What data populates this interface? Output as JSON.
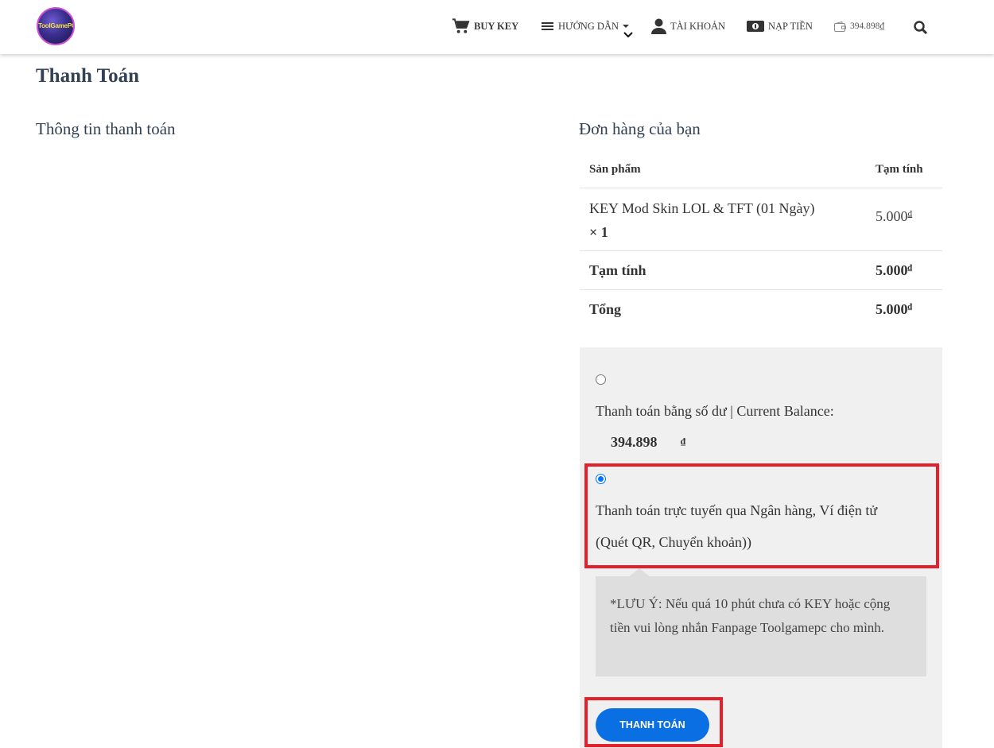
{
  "header": {
    "logo_text": "ToolGamePC",
    "nav": {
      "buy_key": "BUY KEY",
      "huong_dan": "HƯỚNG DẪN",
      "tai_khoan": "TÀI KHOẢN",
      "nap_tien": "NẠP TIỀN",
      "balance": "394.898₫"
    },
    "icons": [
      "cart-icon",
      "menu-icon",
      "chevron-down-icon",
      "user-icon",
      "money-icon",
      "wallet-icon",
      "search-icon"
    ]
  },
  "page": {
    "title": "Thanh Toán",
    "billing_title": "Thông tin thanh toán",
    "order_title": "Đơn hàng của bạn"
  },
  "order": {
    "headers": {
      "product": "Sản phẩm",
      "subtotal": "Tạm tính"
    },
    "item": {
      "name": "KEY Mod Skin LOL & TFT (01 Ngày)",
      "qty": "× 1",
      "price": "5.000",
      "currency": "₫"
    },
    "subtotal_label": "Tạm tính",
    "subtotal_value": "5.000",
    "total_label": "Tổng",
    "total_value": "5.000",
    "currency": "₫"
  },
  "payment": {
    "method1_label": "Thanh toán bằng số dư | Current Balance:",
    "method1_checked": false,
    "balance_value": "394.898",
    "balance_currency": "₫",
    "method2_line1": "Thanh toán trực tuyến qua Ngân hàng, Ví điện tử",
    "method2_line2": "(Quét QR, Chuyển khoản))",
    "method2_checked": true,
    "note": "*LƯU Ý: Nếu quá 10 phút chưa có KEY hoặc cộng tiền vui lòng nhắn Fanpage Toolgamepc cho mình.",
    "button_label": "THANH TOÁN"
  },
  "colors": {
    "accent": "#0a6fe3",
    "highlight": "#e3202b",
    "panel": "#f0f0f0",
    "note_bg": "#dedede"
  }
}
